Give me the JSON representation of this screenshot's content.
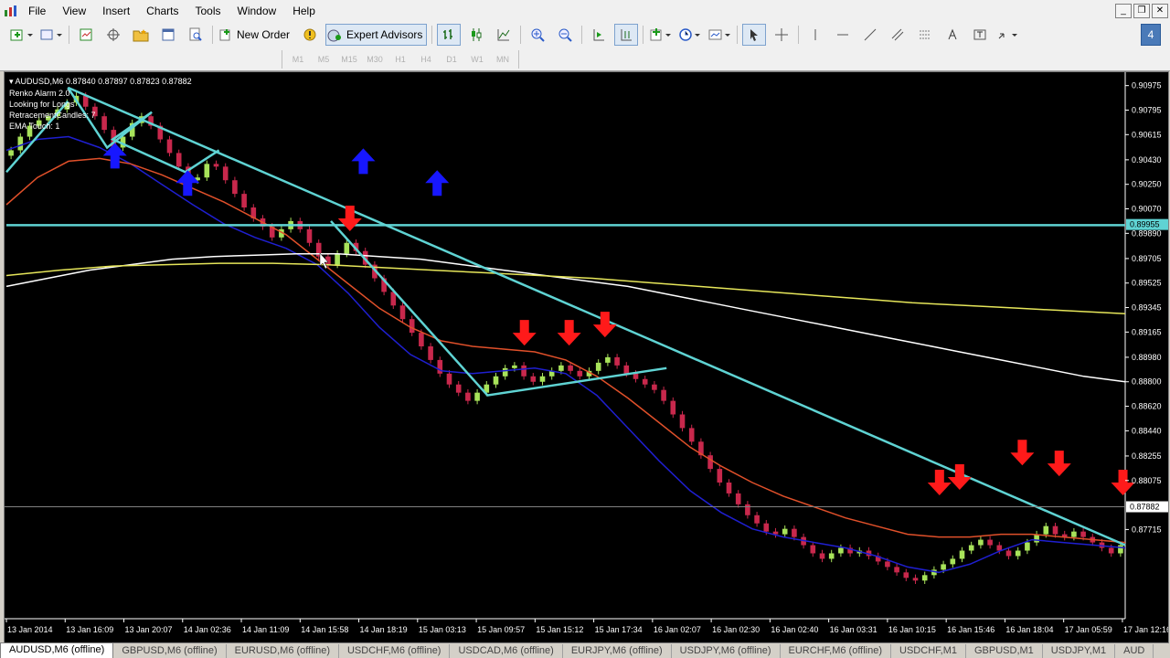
{
  "menubar": {
    "items": [
      "File",
      "View",
      "Insert",
      "Charts",
      "Tools",
      "Window",
      "Help"
    ]
  },
  "toolbar": {
    "new_order_label": "New Order",
    "expert_advisors_label": "Expert Advisors",
    "badge": "4"
  },
  "timeframes": [
    "M1",
    "M5",
    "M15",
    "M30",
    "H1",
    "H4",
    "D1",
    "W1",
    "MN"
  ],
  "chart": {
    "title": "AUDUSD,M6  0.87840 0.87897 0.87823 0.87882",
    "indicators": [
      "Renko Alarm 2.0",
      "Looking for Longs",
      "RetracementCandles: 7",
      "EMA Touch: 1"
    ]
  },
  "chart_data": {
    "type": "candlestick",
    "symbol": "AUDUSD,M6",
    "ylim": [
      0.8706,
      0.9106
    ],
    "y_ticks": [
      "0.90975",
      "0.90795",
      "0.90615",
      "0.90430",
      "0.90250",
      "0.90070",
      "0.89890",
      "0.89705",
      "0.89525",
      "0.89345",
      "0.89165",
      "0.88980",
      "0.88800",
      "0.88620",
      "0.88440",
      "0.88255",
      "0.88075",
      "0.87715"
    ],
    "price_labels": [
      {
        "value": "0.89955",
        "color": "#5fd3d3"
      },
      {
        "value": "0.87882",
        "color": "#ffffff"
      }
    ],
    "x_ticks": [
      "13 Jan 2014",
      "13 Jan 16:09",
      "13 Jan 20:07",
      "14 Jan 02:36",
      "14 Jan 11:09",
      "14 Jan 15:58",
      "14 Jan 18:19",
      "15 Jan 03:13",
      "15 Jan 09:57",
      "15 Jan 15:12",
      "15 Jan 17:34",
      "16 Jan 02:07",
      "16 Jan 02:30",
      "16 Jan 02:40",
      "16 Jan 03:31",
      "16 Jan 10:15",
      "16 Jan 15:46",
      "16 Jan 18:04",
      "17 Jan 05:59",
      "17 Jan 12:16"
    ],
    "close": [
      0.905,
      0.906,
      0.9068,
      0.9072,
      0.9075,
      0.908,
      0.9085,
      0.909,
      0.9082,
      0.9075,
      0.9065,
      0.9052,
      0.906,
      0.907,
      0.9075,
      0.9068,
      0.9058,
      0.9048,
      0.9038,
      0.9028,
      0.903,
      0.904,
      0.9038,
      0.9028,
      0.9018,
      0.9008,
      0.9,
      0.8994,
      0.8986,
      0.8992,
      0.8998,
      0.8992,
      0.8982,
      0.8972,
      0.8966,
      0.8974,
      0.8982,
      0.8976,
      0.8966,
      0.8956,
      0.8946,
      0.8936,
      0.8926,
      0.8916,
      0.8906,
      0.8896,
      0.8886,
      0.8878,
      0.8872,
      0.8866,
      0.8872,
      0.8878,
      0.8884,
      0.889,
      0.8892,
      0.8884,
      0.888,
      0.8884,
      0.8888,
      0.8892,
      0.8888,
      0.8884,
      0.8888,
      0.8894,
      0.8898,
      0.8892,
      0.8886,
      0.8882,
      0.8878,
      0.8874,
      0.8866,
      0.8856,
      0.8846,
      0.8836,
      0.8826,
      0.8816,
      0.8806,
      0.8798,
      0.879,
      0.8782,
      0.8776,
      0.877,
      0.8768,
      0.8772,
      0.8766,
      0.876,
      0.8754,
      0.875,
      0.8754,
      0.8758,
      0.8754,
      0.8756,
      0.8752,
      0.8748,
      0.8744,
      0.874,
      0.8736,
      0.8734,
      0.8738,
      0.8742,
      0.8746,
      0.875,
      0.8756,
      0.876,
      0.8764,
      0.876,
      0.8756,
      0.8752,
      0.8756,
      0.8762,
      0.8768,
      0.8774,
      0.8768,
      0.8766,
      0.877,
      0.8766,
      0.8762,
      0.8758,
      0.8754,
      0.876
    ],
    "series": [
      {
        "type": "line",
        "color": "#1f1fd0",
        "values": [
          0.905,
          0.9058,
          0.906,
          0.9052,
          0.904,
          0.9025,
          0.901,
          0.8996,
          0.8986,
          0.8978,
          0.8966,
          0.8945,
          0.892,
          0.89,
          0.8888,
          0.8886,
          0.8888,
          0.889,
          0.8886,
          0.887,
          0.8846,
          0.8822,
          0.88,
          0.8784,
          0.8772,
          0.8766,
          0.8762,
          0.8758,
          0.8752,
          0.8744,
          0.874,
          0.8746,
          0.8756,
          0.8764,
          0.8762,
          0.876,
          0.8758
        ]
      },
      {
        "type": "line",
        "color": "#e0502a",
        "values": [
          0.901,
          0.903,
          0.9042,
          0.9044,
          0.904,
          0.9032,
          0.9022,
          0.9012,
          0.9,
          0.8988,
          0.897,
          0.8952,
          0.8934,
          0.892,
          0.891,
          0.8906,
          0.8904,
          0.8902,
          0.8896,
          0.8884,
          0.8868,
          0.885,
          0.8832,
          0.8818,
          0.8806,
          0.8796,
          0.8788,
          0.878,
          0.8774,
          0.8768,
          0.8766,
          0.8766,
          0.8768,
          0.8768,
          0.8766,
          0.8764,
          0.8762
        ]
      },
      {
        "type": "line",
        "color": "#ffffff",
        "values": [
          0.895,
          0.8956,
          0.8962,
          0.8966,
          0.897,
          0.8972,
          0.8973,
          0.8974,
          0.8974,
          0.8972,
          0.897,
          0.8966,
          0.8962,
          0.8958,
          0.8954,
          0.895,
          0.8944,
          0.8938,
          0.8932,
          0.8926,
          0.892,
          0.8914,
          0.8908,
          0.8902,
          0.8896,
          0.889,
          0.8884,
          0.888
        ]
      },
      {
        "type": "line",
        "color": "#e6e65a",
        "values": [
          0.8958,
          0.8962,
          0.8965,
          0.8966,
          0.8967,
          0.8967,
          0.8966,
          0.8964,
          0.8962,
          0.896,
          0.8958,
          0.8956,
          0.8953,
          0.895,
          0.8947,
          0.8944,
          0.8941,
          0.8938,
          0.8936,
          0.8934,
          0.8932,
          0.893
        ]
      }
    ],
    "trendlines": [
      {
        "color": "#5fd3d3",
        "points": [
          [
            0.0,
            0.9034
          ],
          [
            0.055,
            0.9086
          ]
        ]
      },
      {
        "color": "#5fd3d3",
        "points": [
          [
            0.055,
            0.9096
          ],
          [
            1.0,
            0.876
          ]
        ]
      },
      {
        "color": "#5fd3d3",
        "points": [
          [
            0.0,
            0.8995
          ],
          [
            1.0,
            0.8995
          ]
        ]
      },
      {
        "color": "#5fd3d3",
        "points": [
          [
            0.055,
            0.9096
          ],
          [
            0.09,
            0.9052
          ],
          [
            0.13,
            0.9078
          ],
          [
            0.095,
            0.9058
          ],
          [
            0.16,
            0.9034
          ],
          [
            0.19,
            0.905
          ]
        ]
      },
      {
        "color": "#5fd3d3",
        "points": [
          [
            0.29,
            0.8998
          ],
          [
            0.43,
            0.887
          ],
          [
            0.59,
            0.889
          ]
        ]
      }
    ],
    "arrows": [
      {
        "dir": "up",
        "color": "#1717ff",
        "x": 0.097,
        "y": 0.9046
      },
      {
        "dir": "up",
        "color": "#1717ff",
        "x": 0.162,
        "y": 0.9026
      },
      {
        "dir": "up",
        "color": "#1717ff",
        "x": 0.319,
        "y": 0.9042
      },
      {
        "dir": "up",
        "color": "#1717ff",
        "x": 0.385,
        "y": 0.9026
      },
      {
        "dir": "down",
        "color": "#ff1a1a",
        "x": 0.307,
        "y": 0.9
      },
      {
        "dir": "down",
        "color": "#ff1a1a",
        "x": 0.463,
        "y": 0.8916
      },
      {
        "dir": "down",
        "color": "#ff1a1a",
        "x": 0.503,
        "y": 0.8916
      },
      {
        "dir": "down",
        "color": "#ff1a1a",
        "x": 0.535,
        "y": 0.8922
      },
      {
        "dir": "down",
        "color": "#ff1a1a",
        "x": 0.834,
        "y": 0.8806
      },
      {
        "dir": "down",
        "color": "#ff1a1a",
        "x": 0.852,
        "y": 0.881
      },
      {
        "dir": "down",
        "color": "#ff1a1a",
        "x": 0.908,
        "y": 0.8828
      },
      {
        "dir": "down",
        "color": "#ff1a1a",
        "x": 0.941,
        "y": 0.882
      },
      {
        "dir": "down",
        "color": "#ff1a1a",
        "x": 0.998,
        "y": 0.8806
      }
    ],
    "candle_up_color": "#a8e35a",
    "candle_down_color": "#c8284c",
    "grid": false,
    "background": "#000000"
  },
  "tabs": [
    {
      "label": "AUDUSD,M6 (offline)",
      "active": true
    },
    {
      "label": "GBPUSD,M6 (offline)",
      "active": false
    },
    {
      "label": "EURUSD,M6 (offline)",
      "active": false
    },
    {
      "label": "USDCHF,M6 (offline)",
      "active": false
    },
    {
      "label": "USDCAD,M6 (offline)",
      "active": false
    },
    {
      "label": "EURJPY,M6 (offline)",
      "active": false
    },
    {
      "label": "USDJPY,M6 (offline)",
      "active": false
    },
    {
      "label": "EURCHF,M6 (offline)",
      "active": false
    },
    {
      "label": "USDCHF,M1",
      "active": false
    },
    {
      "label": "GBPUSD,M1",
      "active": false
    },
    {
      "label": "USDJPY,M1",
      "active": false
    },
    {
      "label": "AUD",
      "active": false
    }
  ]
}
